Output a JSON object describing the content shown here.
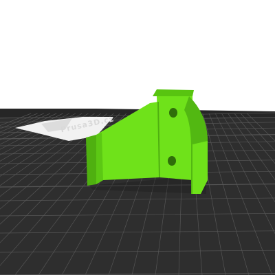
{
  "viewport": {
    "background_color": "#ffffff"
  },
  "print_bed": {
    "surface_color": "#2e2e2e",
    "grid_color": "#5a5a5a",
    "bed_logo_text": "Prusa3D.cz"
  },
  "model": {
    "object": "bracket-part",
    "color": "#6fe21a",
    "shade_color": "#4fb010",
    "dark_color": "#3f9a0c",
    "holes": 2
  }
}
